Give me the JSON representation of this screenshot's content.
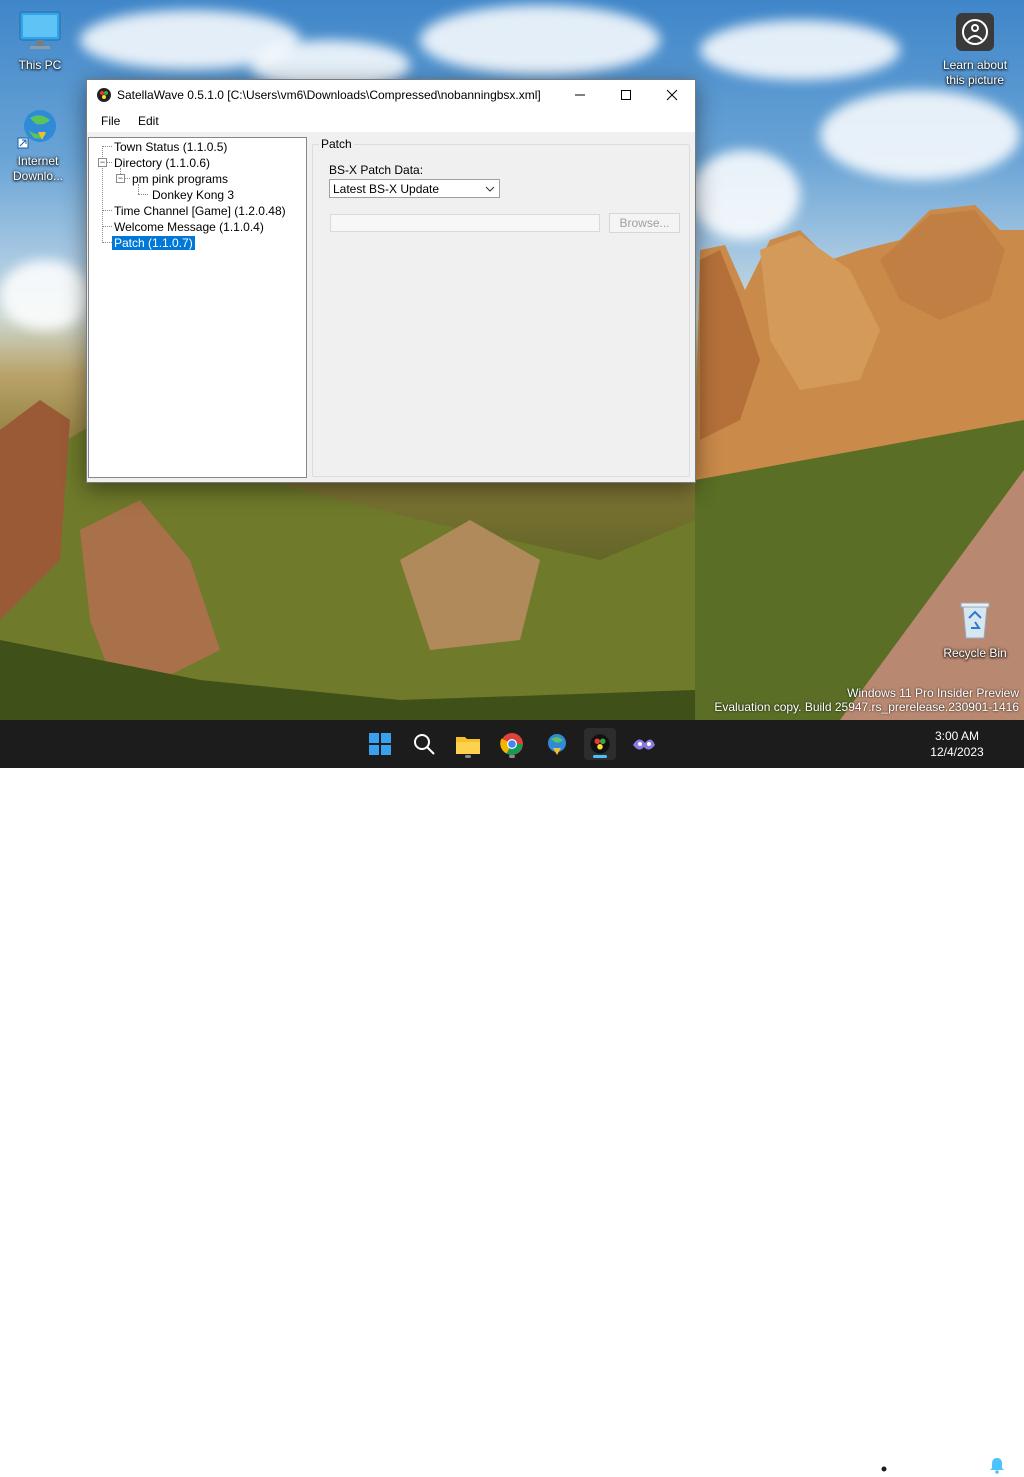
{
  "desktop": {
    "icons": {
      "this_pc": "This PC",
      "internet_download": "Internet Downlo...",
      "learn_about": "Learn about this picture",
      "recycle_bin": "Recycle Bin"
    },
    "watermark": {
      "line1": "Windows 11 Pro Insider Preview",
      "line2": "Evaluation copy. Build 25947.rs_prerelease.230901-1416"
    }
  },
  "window": {
    "title": "SatellaWave 0.5.1.0 [C:\\Users\\vm6\\Downloads\\Compressed\\nobanningbsx.xml]",
    "menu": [
      "File",
      "Edit"
    ],
    "tree": {
      "town_status": "Town Status (1.1.0.5)",
      "directory": "Directory (1.1.0.6)",
      "pm_pink": "pm pink programs",
      "donkey_kong": "Donkey Kong 3",
      "time_channel": "Time Channel [Game] (1.2.0.48)",
      "welcome": "Welcome Message (1.1.0.4)",
      "patch": "Patch (1.1.0.7)"
    },
    "panel": {
      "group_title": "Patch",
      "field_label": "BS-X Patch Data:",
      "select_value": "Latest BS-X Update",
      "path_value": "",
      "browse_label": "Browse..."
    }
  },
  "taskbar": {
    "time": "3:00 AM",
    "date": "12/4/2023",
    "icons": [
      "start-icon",
      "search-icon",
      "file-explorer-icon",
      "chrome-icon",
      "internet-download-manager-icon",
      "satellawave-icon",
      "app-icon"
    ]
  },
  "colors": {
    "selection": "#0078d7",
    "taskbar": "#1c1c1c",
    "accent_indicator": "#4cc2ff"
  }
}
